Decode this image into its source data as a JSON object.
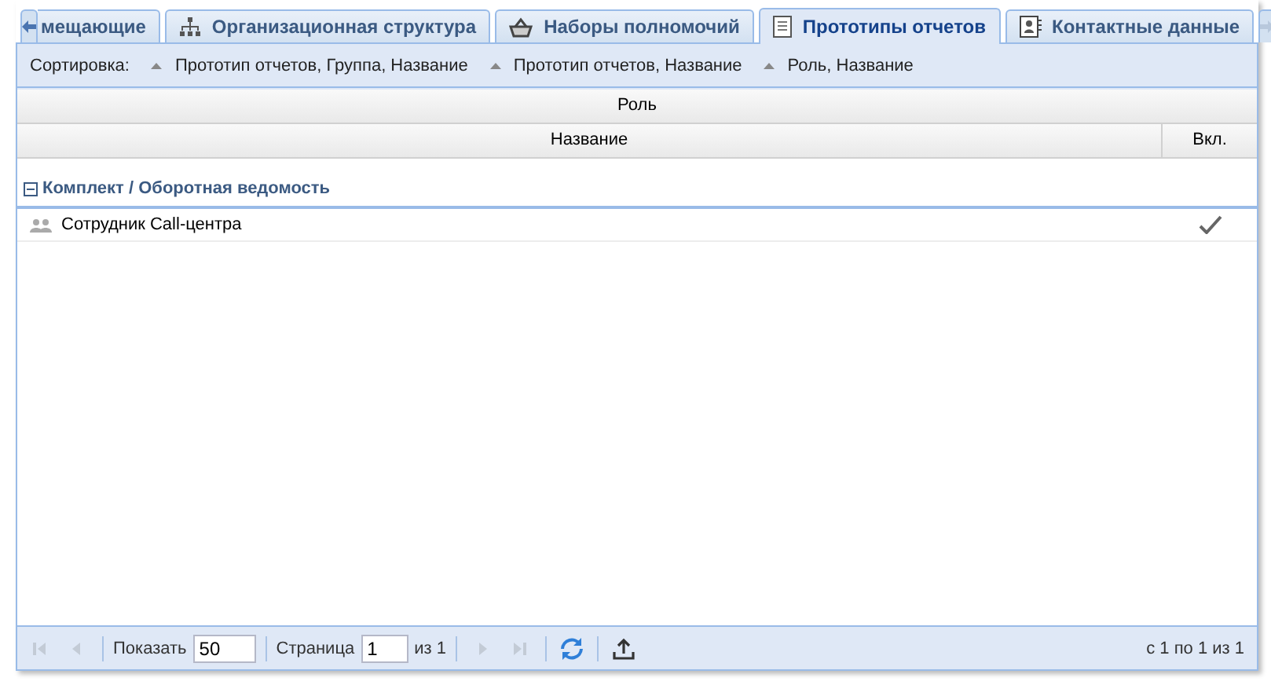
{
  "tabs": [
    {
      "label": "мещающие",
      "selected": false
    },
    {
      "label": "Организационная структура",
      "selected": false
    },
    {
      "label": "Наборы полномочий",
      "selected": false
    },
    {
      "label": "Прототипы отчетов",
      "selected": true
    },
    {
      "label": "Контактные данные",
      "selected": false
    }
  ],
  "sort_bar": {
    "label": "Сортировка:",
    "items": [
      "Прототип отчетов, Группа, Название",
      "Прототип отчетов, Название",
      "Роль, Название"
    ]
  },
  "table": {
    "group_header": "Роль",
    "columns": [
      "Название",
      "Вкл."
    ],
    "groups": [
      {
        "title": "Комплект / Оборотная ведомость",
        "expanded": true,
        "rows": [
          {
            "name": "Сотрудник Call-центра",
            "enabled": true
          }
        ]
      }
    ]
  },
  "pager": {
    "first_disabled": true,
    "prev_disabled": true,
    "next_disabled": true,
    "last_disabled": true,
    "show_label": "Показать",
    "page_size": "50",
    "page_label": "Страница",
    "page": "1",
    "of_label": "из 1",
    "summary": "с 1 по 1 из 1"
  }
}
